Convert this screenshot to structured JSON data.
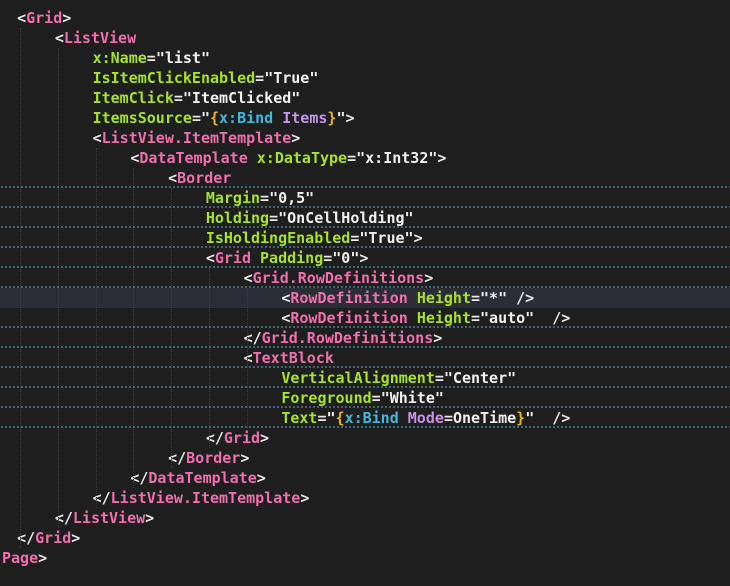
{
  "editor": {
    "lines": [
      {
        "indent": 2,
        "tokens": [
          [
            "p",
            "<"
          ],
          [
            "t",
            "Grid"
          ],
          [
            "p",
            ">"
          ]
        ]
      },
      {
        "indent": 7,
        "tokens": [
          [
            "p",
            "<"
          ],
          [
            "t",
            "ListView"
          ]
        ]
      },
      {
        "indent": 12,
        "tokens": [
          [
            "a",
            "x:Name"
          ],
          [
            "e",
            "="
          ],
          [
            "s",
            "\"list\""
          ]
        ]
      },
      {
        "indent": 12,
        "tokens": [
          [
            "a",
            "IsItemClickEnabled"
          ],
          [
            "e",
            "="
          ],
          [
            "s",
            "\"True\""
          ]
        ]
      },
      {
        "indent": 12,
        "tokens": [
          [
            "a",
            "ItemClick"
          ],
          [
            "e",
            "="
          ],
          [
            "s",
            "\"ItemClicked\""
          ]
        ]
      },
      {
        "indent": 12,
        "tokens": [
          [
            "a",
            "ItemsSource"
          ],
          [
            "e",
            "="
          ],
          [
            "s",
            "\""
          ],
          [
            "b",
            "{"
          ],
          [
            "k",
            "x:Bind"
          ],
          [
            "s",
            " "
          ],
          [
            "v",
            "Items"
          ],
          [
            "b",
            "}"
          ],
          [
            "s",
            "\""
          ],
          [
            "p",
            ">"
          ]
        ]
      },
      {
        "indent": 12,
        "tokens": [
          [
            "p",
            "<"
          ],
          [
            "t",
            "ListView.ItemTemplate"
          ],
          [
            "p",
            ">"
          ]
        ]
      },
      {
        "indent": 17,
        "tokens": [
          [
            "p",
            "<"
          ],
          [
            "t",
            "DataTemplate"
          ],
          [
            "s",
            " "
          ],
          [
            "a",
            "x:DataType"
          ],
          [
            "e",
            "="
          ],
          [
            "s",
            "\"x:Int32\""
          ],
          [
            "p",
            ">"
          ]
        ]
      },
      {
        "indent": 22,
        "tokens": [
          [
            "p",
            "<"
          ],
          [
            "t",
            "Border"
          ]
        ]
      },
      {
        "indent": 27,
        "tokens": [
          [
            "a",
            "Margin"
          ],
          [
            "e",
            "="
          ],
          [
            "s",
            "\"0,5\""
          ]
        ]
      },
      {
        "indent": 27,
        "tokens": [
          [
            "a",
            "Holding"
          ],
          [
            "e",
            "="
          ],
          [
            "s",
            "\"OnCellHolding\""
          ]
        ]
      },
      {
        "indent": 27,
        "tokens": [
          [
            "a",
            "IsHoldingEnabled"
          ],
          [
            "e",
            "="
          ],
          [
            "s",
            "\"True\""
          ],
          [
            "p",
            ">"
          ]
        ]
      },
      {
        "indent": 27,
        "tokens": [
          [
            "p",
            "<"
          ],
          [
            "t",
            "Grid"
          ],
          [
            "s",
            " "
          ],
          [
            "a",
            "Padding"
          ],
          [
            "e",
            "="
          ],
          [
            "s",
            "\"0\""
          ],
          [
            "p",
            ">"
          ]
        ]
      },
      {
        "indent": 32,
        "tokens": [
          [
            "p",
            "<"
          ],
          [
            "t",
            "Grid.RowDefinitions"
          ],
          [
            "p",
            ">"
          ]
        ]
      },
      {
        "indent": 37,
        "tokens": [
          [
            "p",
            "<"
          ],
          [
            "t",
            "RowDefinition"
          ],
          [
            "s",
            " "
          ],
          [
            "a",
            "Height"
          ],
          [
            "e",
            "="
          ],
          [
            "s",
            "\"*\""
          ],
          [
            "s",
            " "
          ],
          [
            "p",
            "/>"
          ]
        ]
      },
      {
        "indent": 37,
        "tokens": [
          [
            "p",
            "<"
          ],
          [
            "t",
            "RowDefinition"
          ],
          [
            "s",
            " "
          ],
          [
            "a",
            "Height"
          ],
          [
            "e",
            "="
          ],
          [
            "s",
            "\"auto\""
          ],
          [
            "s",
            "  "
          ],
          [
            "p",
            "/>"
          ]
        ]
      },
      {
        "indent": 32,
        "tokens": [
          [
            "p",
            "</"
          ],
          [
            "t",
            "Grid.RowDefinitions"
          ],
          [
            "p",
            ">"
          ]
        ]
      },
      {
        "indent": 32,
        "tokens": [
          [
            "p",
            "<"
          ],
          [
            "t",
            "TextBlock"
          ]
        ]
      },
      {
        "indent": 37,
        "tokens": [
          [
            "a",
            "VerticalAlignment"
          ],
          [
            "e",
            "="
          ],
          [
            "s",
            "\"Center\""
          ]
        ]
      },
      {
        "indent": 37,
        "tokens": [
          [
            "a",
            "Foreground"
          ],
          [
            "e",
            "="
          ],
          [
            "s",
            "\"White\""
          ]
        ]
      },
      {
        "indent": 37,
        "tokens": [
          [
            "a",
            "Text"
          ],
          [
            "e",
            "="
          ],
          [
            "s",
            "\""
          ],
          [
            "b",
            "{"
          ],
          [
            "k",
            "x:Bind"
          ],
          [
            "s",
            " "
          ],
          [
            "v",
            "Mode"
          ],
          [
            "e",
            "="
          ],
          [
            "s",
            "OneTime"
          ],
          [
            "b",
            "}"
          ],
          [
            "s",
            "\""
          ],
          [
            "s",
            "  "
          ],
          [
            "p",
            "/>"
          ]
        ]
      },
      {
        "indent": 27,
        "tokens": [
          [
            "p",
            "</"
          ],
          [
            "t",
            "Grid"
          ],
          [
            "p",
            ">"
          ]
        ]
      },
      {
        "indent": 22,
        "tokens": [
          [
            "p",
            "</"
          ],
          [
            "t",
            "Border"
          ],
          [
            "p",
            ">"
          ]
        ]
      },
      {
        "indent": 17,
        "tokens": [
          [
            "p",
            "</"
          ],
          [
            "t",
            "DataTemplate"
          ],
          [
            "p",
            ">"
          ]
        ]
      },
      {
        "indent": 12,
        "tokens": [
          [
            "p",
            "</"
          ],
          [
            "t",
            "ListView.ItemTemplate"
          ],
          [
            "p",
            ">"
          ]
        ]
      },
      {
        "indent": 7,
        "tokens": [
          [
            "p",
            "</"
          ],
          [
            "t",
            "ListView"
          ],
          [
            "p",
            ">"
          ]
        ]
      },
      {
        "indent": 2,
        "tokens": [
          [
            "p",
            "</"
          ],
          [
            "t",
            "Grid"
          ],
          [
            "p",
            ">"
          ]
        ]
      },
      {
        "indent": 0,
        "tokens": [
          [
            "t",
            "Page"
          ],
          [
            "p",
            ">"
          ]
        ]
      }
    ],
    "current_line": 14,
    "squiggle_after_lines": [
      8,
      9,
      10,
      11,
      12,
      13,
      15,
      16,
      17,
      18,
      19,
      20
    ],
    "colors": {
      "background": "#1e1e1e",
      "tag": "#f06fae",
      "attribute": "#a6e22e",
      "string": "#f1f1f1",
      "punctuation": "#e8e8e8",
      "brace": "#e6b422",
      "bind_keyword": "#42b8dd",
      "bind_property": "#c792ea",
      "current_line": "#2a2d35"
    }
  }
}
